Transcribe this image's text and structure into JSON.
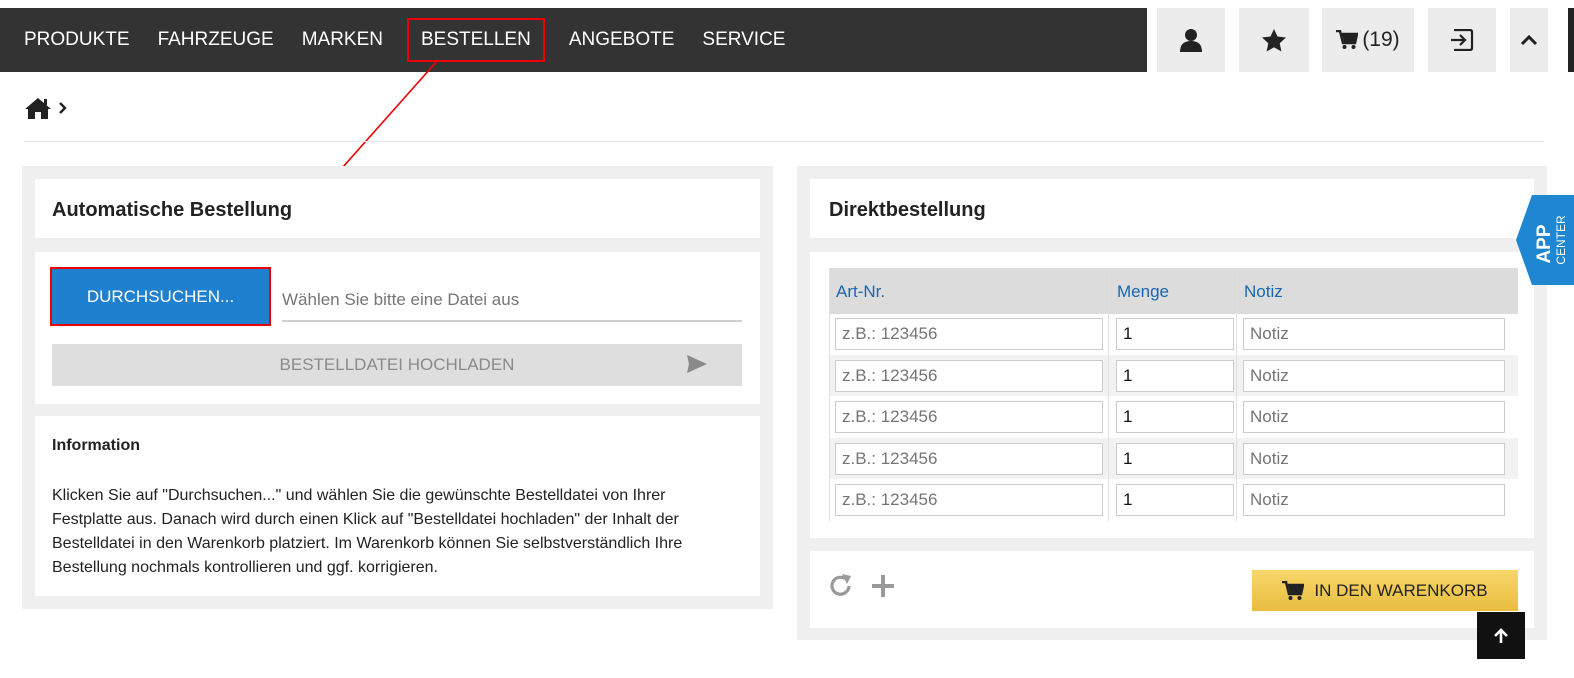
{
  "nav": {
    "items": [
      {
        "label": "PRODUKTE"
      },
      {
        "label": "FAHRZEUGE"
      },
      {
        "label": "MARKEN"
      },
      {
        "label": "BESTELLEN"
      },
      {
        "label": "ANGEBOTE"
      },
      {
        "label": "SERVICE"
      }
    ]
  },
  "toolbar": {
    "cart_count": "(19)",
    "icons": [
      "user-icon",
      "star-icon",
      "cart-icon",
      "logout-icon",
      "chevron-up-icon"
    ]
  },
  "breadcrumb": {
    "separator": ">"
  },
  "auto_order": {
    "title": "Automatische Bestellung",
    "browse_label": "DURCHSUCHEN...",
    "file_placeholder": "Wählen Sie bitte eine Datei aus",
    "upload_label": "BESTELLDATEI HOCHLADEN",
    "info_title": "Information",
    "info_text": "Klicken Sie auf \"Durchsuchen...\" und wählen Sie die gewünschte Bestelldatei von Ihrer Festplatte aus. Danach wird durch einen Klick auf \"Bestelldatei hochladen\" der Inhalt der Bestelldatei in den Warenkorb platziert. Im Warenkorb können Sie selbstverständlich Ihre Bestellung nochmals kontrollieren und ggf. korrigieren."
  },
  "direct_order": {
    "title": "Direktbestellung",
    "columns": [
      "Art-Nr.",
      "Menge",
      "Notiz"
    ],
    "rows": [
      {
        "artnr_placeholder": "z.B.: 123456",
        "qty": "1",
        "note_placeholder": "Notiz"
      },
      {
        "artnr_placeholder": "z.B.: 123456",
        "qty": "1",
        "note_placeholder": "Notiz"
      },
      {
        "artnr_placeholder": "z.B.: 123456",
        "qty": "1",
        "note_placeholder": "Notiz"
      },
      {
        "artnr_placeholder": "z.B.: 123456",
        "qty": "1",
        "note_placeholder": "Notiz"
      },
      {
        "artnr_placeholder": "z.B.: 123456",
        "qty": "1",
        "note_placeholder": "Notiz"
      }
    ],
    "add_to_cart_label": "IN DEN WARENKORB"
  },
  "app_center": {
    "line1": "APP",
    "line2": "CENTER"
  },
  "colors": {
    "topbar": "#333333",
    "primary_button": "#1f80d0",
    "cart_button": "#f0c850",
    "annotation": "#e00000",
    "table_header_text": "#1a66b0"
  }
}
